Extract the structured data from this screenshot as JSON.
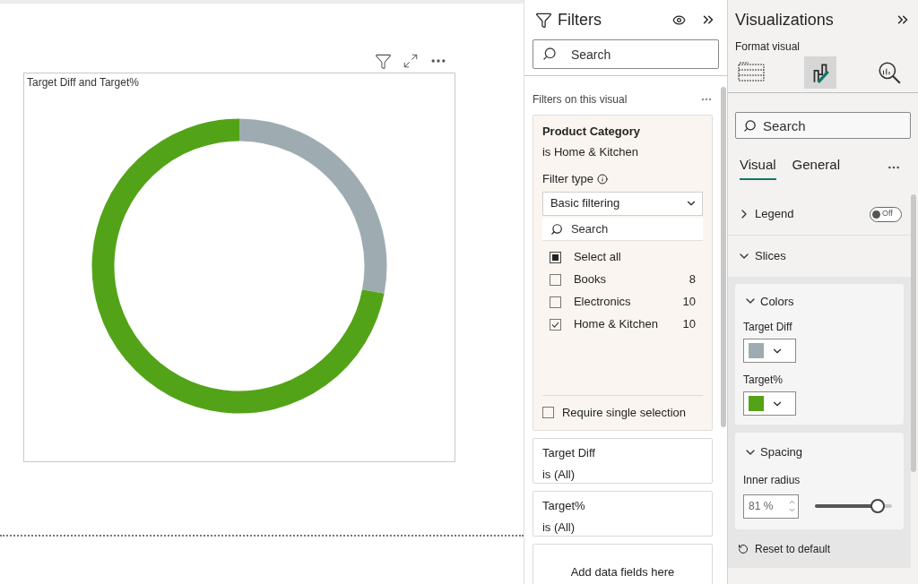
{
  "visual": {
    "title": "Target Diff and Target%"
  },
  "filters": {
    "title": "Filters",
    "search": {
      "placeholder": "Search"
    },
    "section": "Filters on this visual",
    "cards": [
      {
        "kind": "expanded",
        "field": "Product Category",
        "summary": "is Home & Kitchen",
        "filter_type_label": "Filter type",
        "filter_type": "Basic filtering",
        "search": {
          "placeholder": "Search"
        },
        "items": [
          {
            "label": "Select all",
            "indeterminate": true
          },
          {
            "label": "Books",
            "count": "8",
            "checked": false
          },
          {
            "label": "Electronics",
            "count": "10",
            "checked": false
          },
          {
            "label": "Home & Kitchen",
            "count": "10",
            "checked": true
          }
        ],
        "require_single": {
          "label": "Require single selection",
          "checked": false
        }
      },
      {
        "kind": "collapsed",
        "field": "Target Diff",
        "summary": "is (All)"
      },
      {
        "kind": "collapsed",
        "field": "Target%",
        "summary": "is (All)"
      },
      {
        "kind": "drop",
        "field": "Add data fields here"
      }
    ]
  },
  "visualizations": {
    "title": "Visualizations",
    "subtitle": "Format visual",
    "panes": [
      {
        "kind": "build",
        "selected": false
      },
      {
        "kind": "format",
        "selected": true
      },
      {
        "kind": "analytics",
        "selected": false
      }
    ],
    "search": {
      "placeholder": "Search"
    },
    "tabs": [
      {
        "label": "Visual",
        "selected": true
      },
      {
        "label": "General",
        "selected": false
      }
    ],
    "legend": {
      "label": "Legend",
      "expanded": false,
      "on": false,
      "toggle_text": "Off"
    },
    "slices": {
      "label": "Slices",
      "expanded": true
    },
    "colors": {
      "label": "Colors",
      "expanded": true,
      "items": [
        {
          "label": "Target Diff",
          "color": "#9eacb2"
        },
        {
          "label": "Target%",
          "color": "#53a318"
        }
      ]
    },
    "spacing": {
      "label": "Spacing",
      "expanded": true,
      "field_label": "Inner radius",
      "value": "81",
      "unit": "%",
      "level": 0.81
    },
    "reset": "Reset to default"
  }
}
